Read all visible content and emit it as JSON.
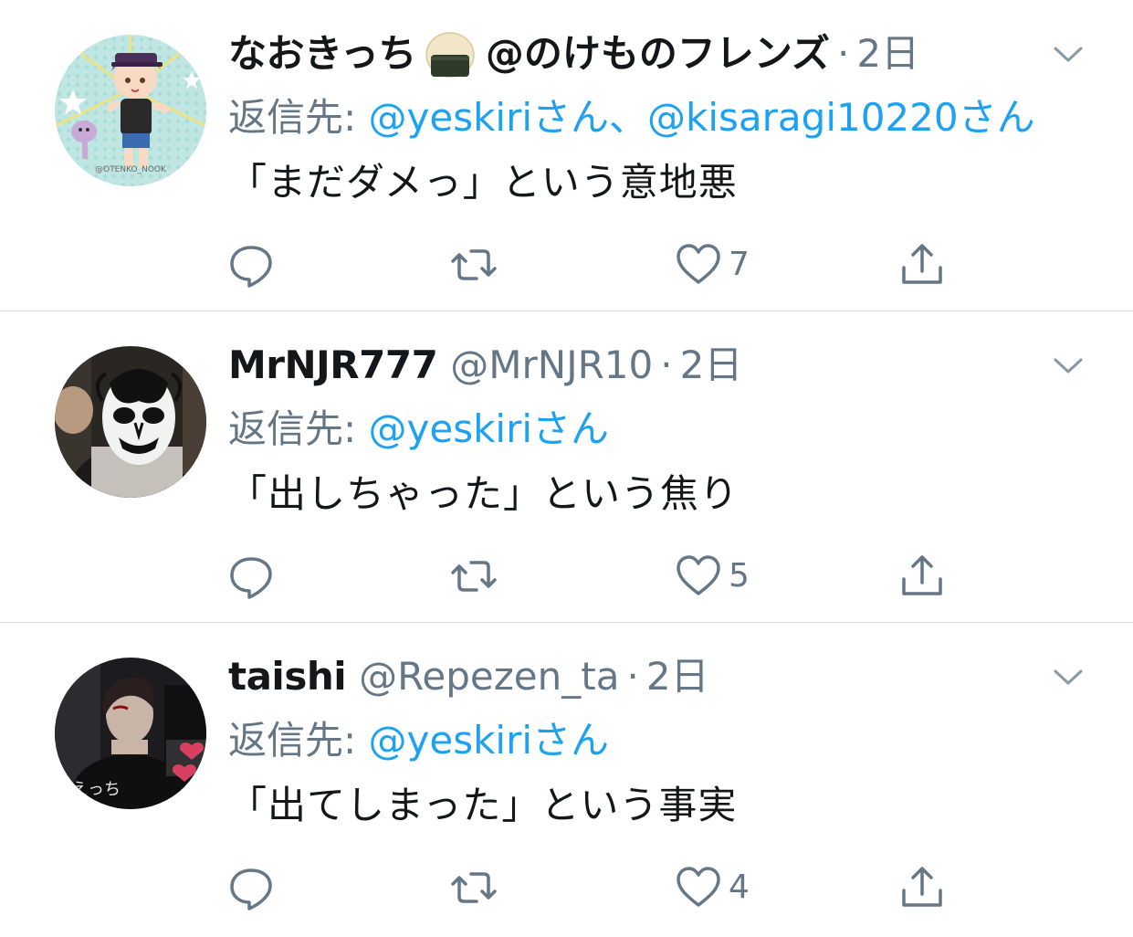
{
  "tweets": [
    {
      "display_name": "なおきっち",
      "name_emoji": "onigiri-emoji",
      "handle": "@のけものフレンズ",
      "dot": "·",
      "time": "2日",
      "reply_prefix": "返信先: ",
      "mentions": [
        "@yeskiriさん",
        "@kisaragi10220さん"
      ],
      "mention_separator": "、",
      "text": "「まだダメっ」という意地悪",
      "like_count": "7",
      "avatar_icon": "anime-character-avatar"
    },
    {
      "display_name": "MrNJR777",
      "handle": "@MrNJR10",
      "dot": "·",
      "time": "2日",
      "reply_prefix": "返信先: ",
      "mentions": [
        "@yeskiriさん"
      ],
      "text": "「出しちゃった」という焦り",
      "like_count": "5",
      "avatar_icon": "masked-wrestler-avatar"
    },
    {
      "display_name": "taishi",
      "handle": "@Repezen_ta",
      "dot": "·",
      "time": "2日",
      "reply_prefix": "返信先: ",
      "mentions": [
        "@yeskiriさん"
      ],
      "text": "「出てしまった」という事実",
      "like_count": "4",
      "avatar_icon": "person-photo-avatar",
      "avatar_text": "えっち"
    }
  ],
  "colors": {
    "text": "#14171a",
    "secondary": "#657786",
    "link": "#1da1f2",
    "divider": "#d6dade"
  },
  "icons": [
    "reply-icon",
    "retweet-icon",
    "like-icon",
    "share-icon",
    "chevron-down-icon"
  ]
}
